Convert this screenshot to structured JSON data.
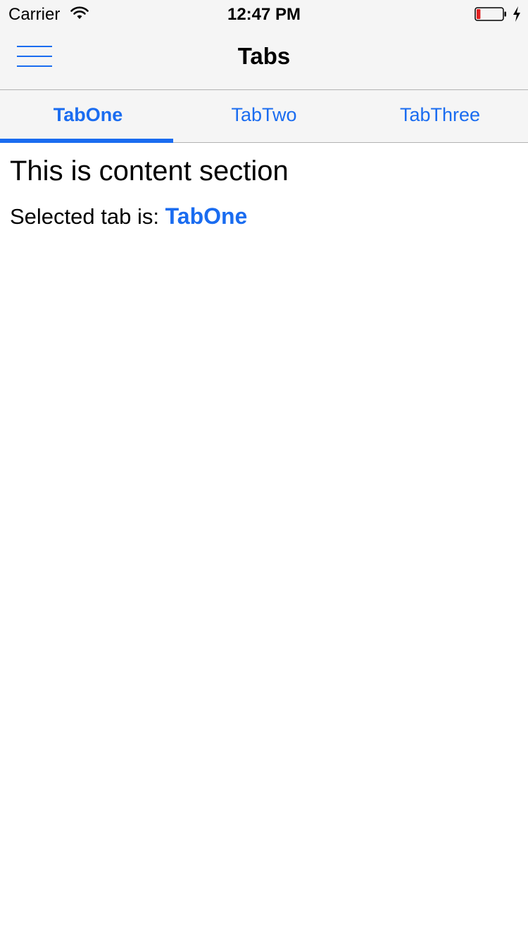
{
  "status_bar": {
    "carrier": "Carrier",
    "time": "12:47 PM",
    "wifi_icon": "wifi-icon",
    "battery_icon": "battery-low-icon",
    "charging_icon": "bolt-icon",
    "battery_level": 0.15
  },
  "nav": {
    "title": "Tabs",
    "menu_icon": "hamburger-menu-icon"
  },
  "tabs": [
    {
      "label": "TabOne",
      "selected": true
    },
    {
      "label": "TabTwo",
      "selected": false
    },
    {
      "label": "TabThree",
      "selected": false
    }
  ],
  "content": {
    "heading": "This is content section",
    "selected_label": "Selected tab is:",
    "selected_value": "TabOne"
  },
  "colors": {
    "accent": "#1a6cf0",
    "bar_background": "#f5f5f5",
    "battery_low": "#e02020"
  }
}
